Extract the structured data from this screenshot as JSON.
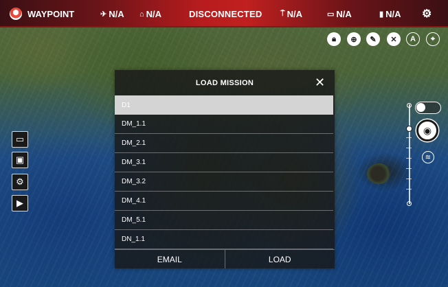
{
  "header": {
    "app_title": "WAYPOINT",
    "connection_status": "DISCONNECTED",
    "indicators": [
      {
        "icon": "satellite-icon",
        "value": "N/A"
      },
      {
        "icon": "battery-aircraft-icon",
        "value": "N/A"
      },
      {
        "icon": "remote-controller-signal-icon",
        "value": "N/A"
      },
      {
        "icon": "video-signal-icon",
        "value": "N/A"
      },
      {
        "icon": "battery-icon",
        "value": "N/A"
      }
    ],
    "settings_icon": "gear-icon"
  },
  "tools": {
    "lock_icon": "lock-icon",
    "add_waypoint_icon": "add-waypoint-icon",
    "wrench_icon": "wrench-icon",
    "clear_icon": "close-icon",
    "auto_label": "A",
    "locate_icon": "crosshair-icon"
  },
  "left_toolbar": {
    "items": [
      "folder-icon",
      "save-icon",
      "mission-settings-icon",
      "play-icon"
    ]
  },
  "right_controls": {
    "toggle_state": "off",
    "camera_icon": "camera-icon",
    "filter_icon": "filter-icon"
  },
  "dialog": {
    "title": "LOAD MISSION",
    "close_icon": "close-icon",
    "missions": [
      "D1",
      "DM_1.1",
      "DM_2.1",
      "DM_3.1",
      "DM_3.2",
      "DM_4.1",
      "DM_5.1",
      "DN_1.1"
    ],
    "selected_index": 0,
    "email_label": "EMAIL",
    "load_label": "LOAD"
  },
  "colors": {
    "header_red": "#c0201f",
    "selected_row": "#d4d4d4",
    "dialog_bg": "#191919"
  }
}
